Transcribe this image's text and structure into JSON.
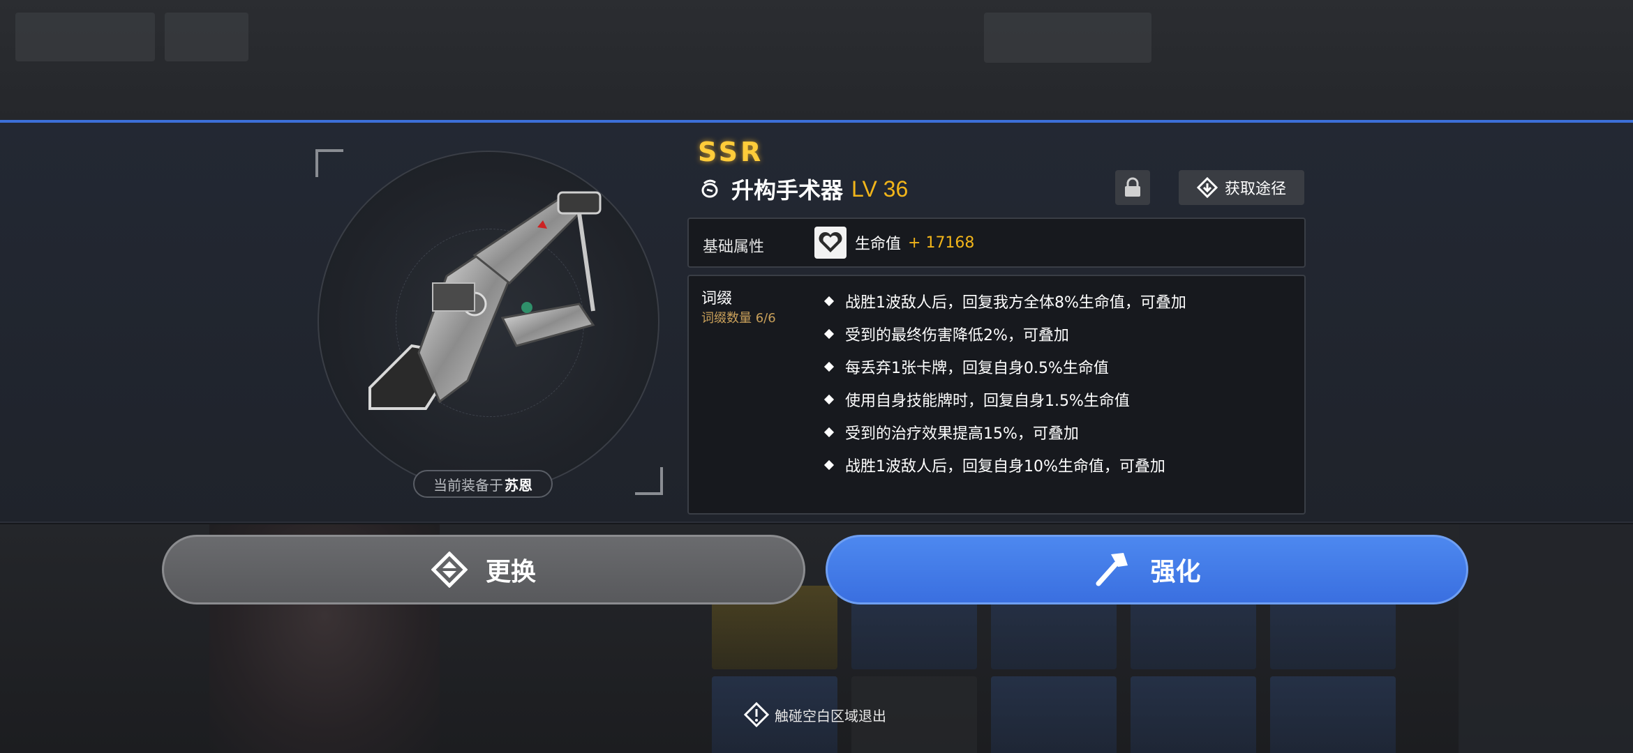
{
  "item": {
    "rarity": "SSR",
    "name": "升构手术器",
    "level": "LV 36",
    "equipped_prefix": "当前装备于",
    "equipped_to": "苏恩"
  },
  "header": {
    "source_label": "获取途径",
    "lock_icon": "lock-icon",
    "source_icon": "diamond-arrow-icon"
  },
  "basic": {
    "label": "基础属性",
    "stat_name": "生命值",
    "stat_value": "+ 17168",
    "stat_icon": "heart-icon"
  },
  "affix": {
    "title": "词缀",
    "count": "词缀数量 6/6",
    "items": [
      "战胜1波敌人后，回复我方全体8%生命值，可叠加",
      "受到的最终伤害降低2%，可叠加",
      "每丢弃1张卡牌，回复自身0.5%生命值",
      "使用自身技能牌时，回复自身1.5%生命值",
      "受到的治疗效果提高15%，可叠加",
      "战胜1波敌人后，回复自身10%生命值，可叠加"
    ]
  },
  "actions": {
    "swap_label": "更换",
    "upgrade_label": "强化"
  },
  "hint": "触碰空白区域退出",
  "colors": {
    "accent_blue": "#3a6fe0",
    "rarity_gold": "#ffcc3a",
    "value_gold": "#f2b51a",
    "affix_count": "#c9a05a"
  }
}
